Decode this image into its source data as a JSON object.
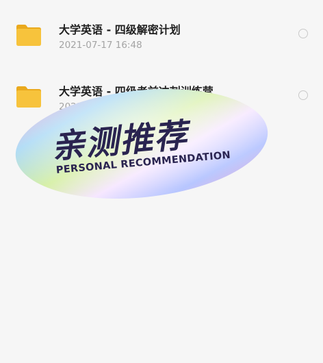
{
  "files": [
    {
      "name": "大学英语 - 四级解密计划",
      "meta": "2021-07-17  16:48",
      "icon": "folder-icon",
      "selected": false
    },
    {
      "name": "大学英语 - 四级考前冲刺训练营",
      "meta": "2021-07-17  16:48",
      "icon": "folder-icon",
      "selected": false
    }
  ],
  "sticker": {
    "title": "亲测推荐",
    "subtitle": "PERSONAL RECOMMENDATION"
  },
  "colors": {
    "background": "#f6f6f6",
    "folder": "#f7c33c",
    "folder_dark": "#eaa91d",
    "title_text": "#1f1f1f",
    "meta_text": "#a4a4a4",
    "sticker_text": "#2a2450"
  }
}
